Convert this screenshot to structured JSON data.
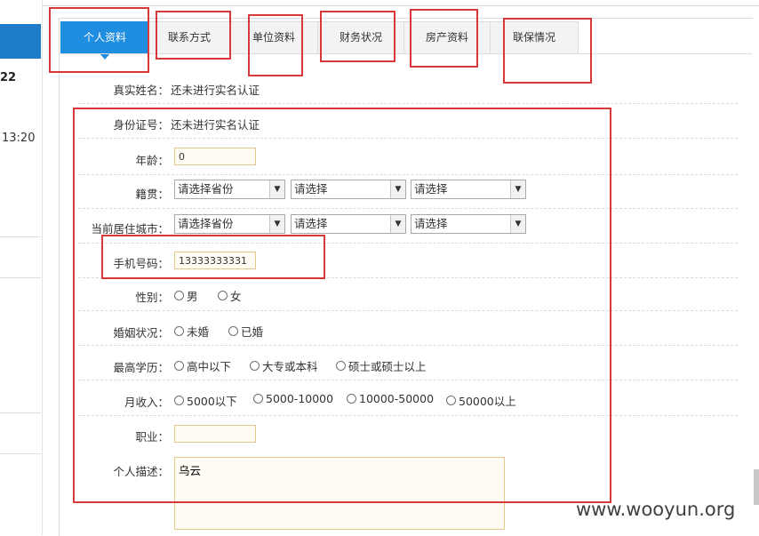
{
  "sidebar": {
    "text_1": "22",
    "text_2": "13:20"
  },
  "tabs": [
    {
      "label": "个人资料",
      "active": true
    },
    {
      "label": "联系方式",
      "active": false
    },
    {
      "label": "单位资料",
      "active": false
    },
    {
      "label": "财务状况",
      "active": false
    },
    {
      "label": "房产资料",
      "active": false
    },
    {
      "label": "联保情况",
      "active": false
    }
  ],
  "form": {
    "real_name": {
      "label": "真实姓名：",
      "value": "还未进行实名认证"
    },
    "id_number": {
      "label": "身份证号：",
      "value": "还未进行实名认证"
    },
    "age": {
      "label": "年龄：",
      "value": "0"
    },
    "native_place": {
      "label": "籍贯：",
      "province": "请选择省份",
      "city": "请选择",
      "district": "请选择"
    },
    "current_city": {
      "label": "当前居住城市：",
      "province": "请选择省份",
      "city": "请选择",
      "district": "请选择"
    },
    "phone": {
      "label": "手机号码：",
      "value": "13333333331"
    },
    "gender": {
      "label": "性别：",
      "options": [
        "男",
        "女"
      ]
    },
    "marital": {
      "label": "婚姻状况：",
      "options": [
        "未婚",
        "已婚"
      ]
    },
    "education": {
      "label": "最高学历：",
      "options": [
        "高中以下",
        "大专或本科",
        "硕士或硕士以上"
      ]
    },
    "income": {
      "label": "月收入：",
      "options": [
        "5000以下",
        "5000-10000",
        "10000-50000",
        "50000以上"
      ]
    },
    "occupation": {
      "label": "职业：",
      "value": ""
    },
    "description": {
      "label": "个人描述：",
      "value": "乌云"
    }
  },
  "watermark": "www.wooyun.org",
  "colors": {
    "tab_active": "#1f8de0",
    "sidebar_blue": "#1e7cc9",
    "annotation_red": "#d9383a",
    "input_border": "#e6c98a"
  }
}
